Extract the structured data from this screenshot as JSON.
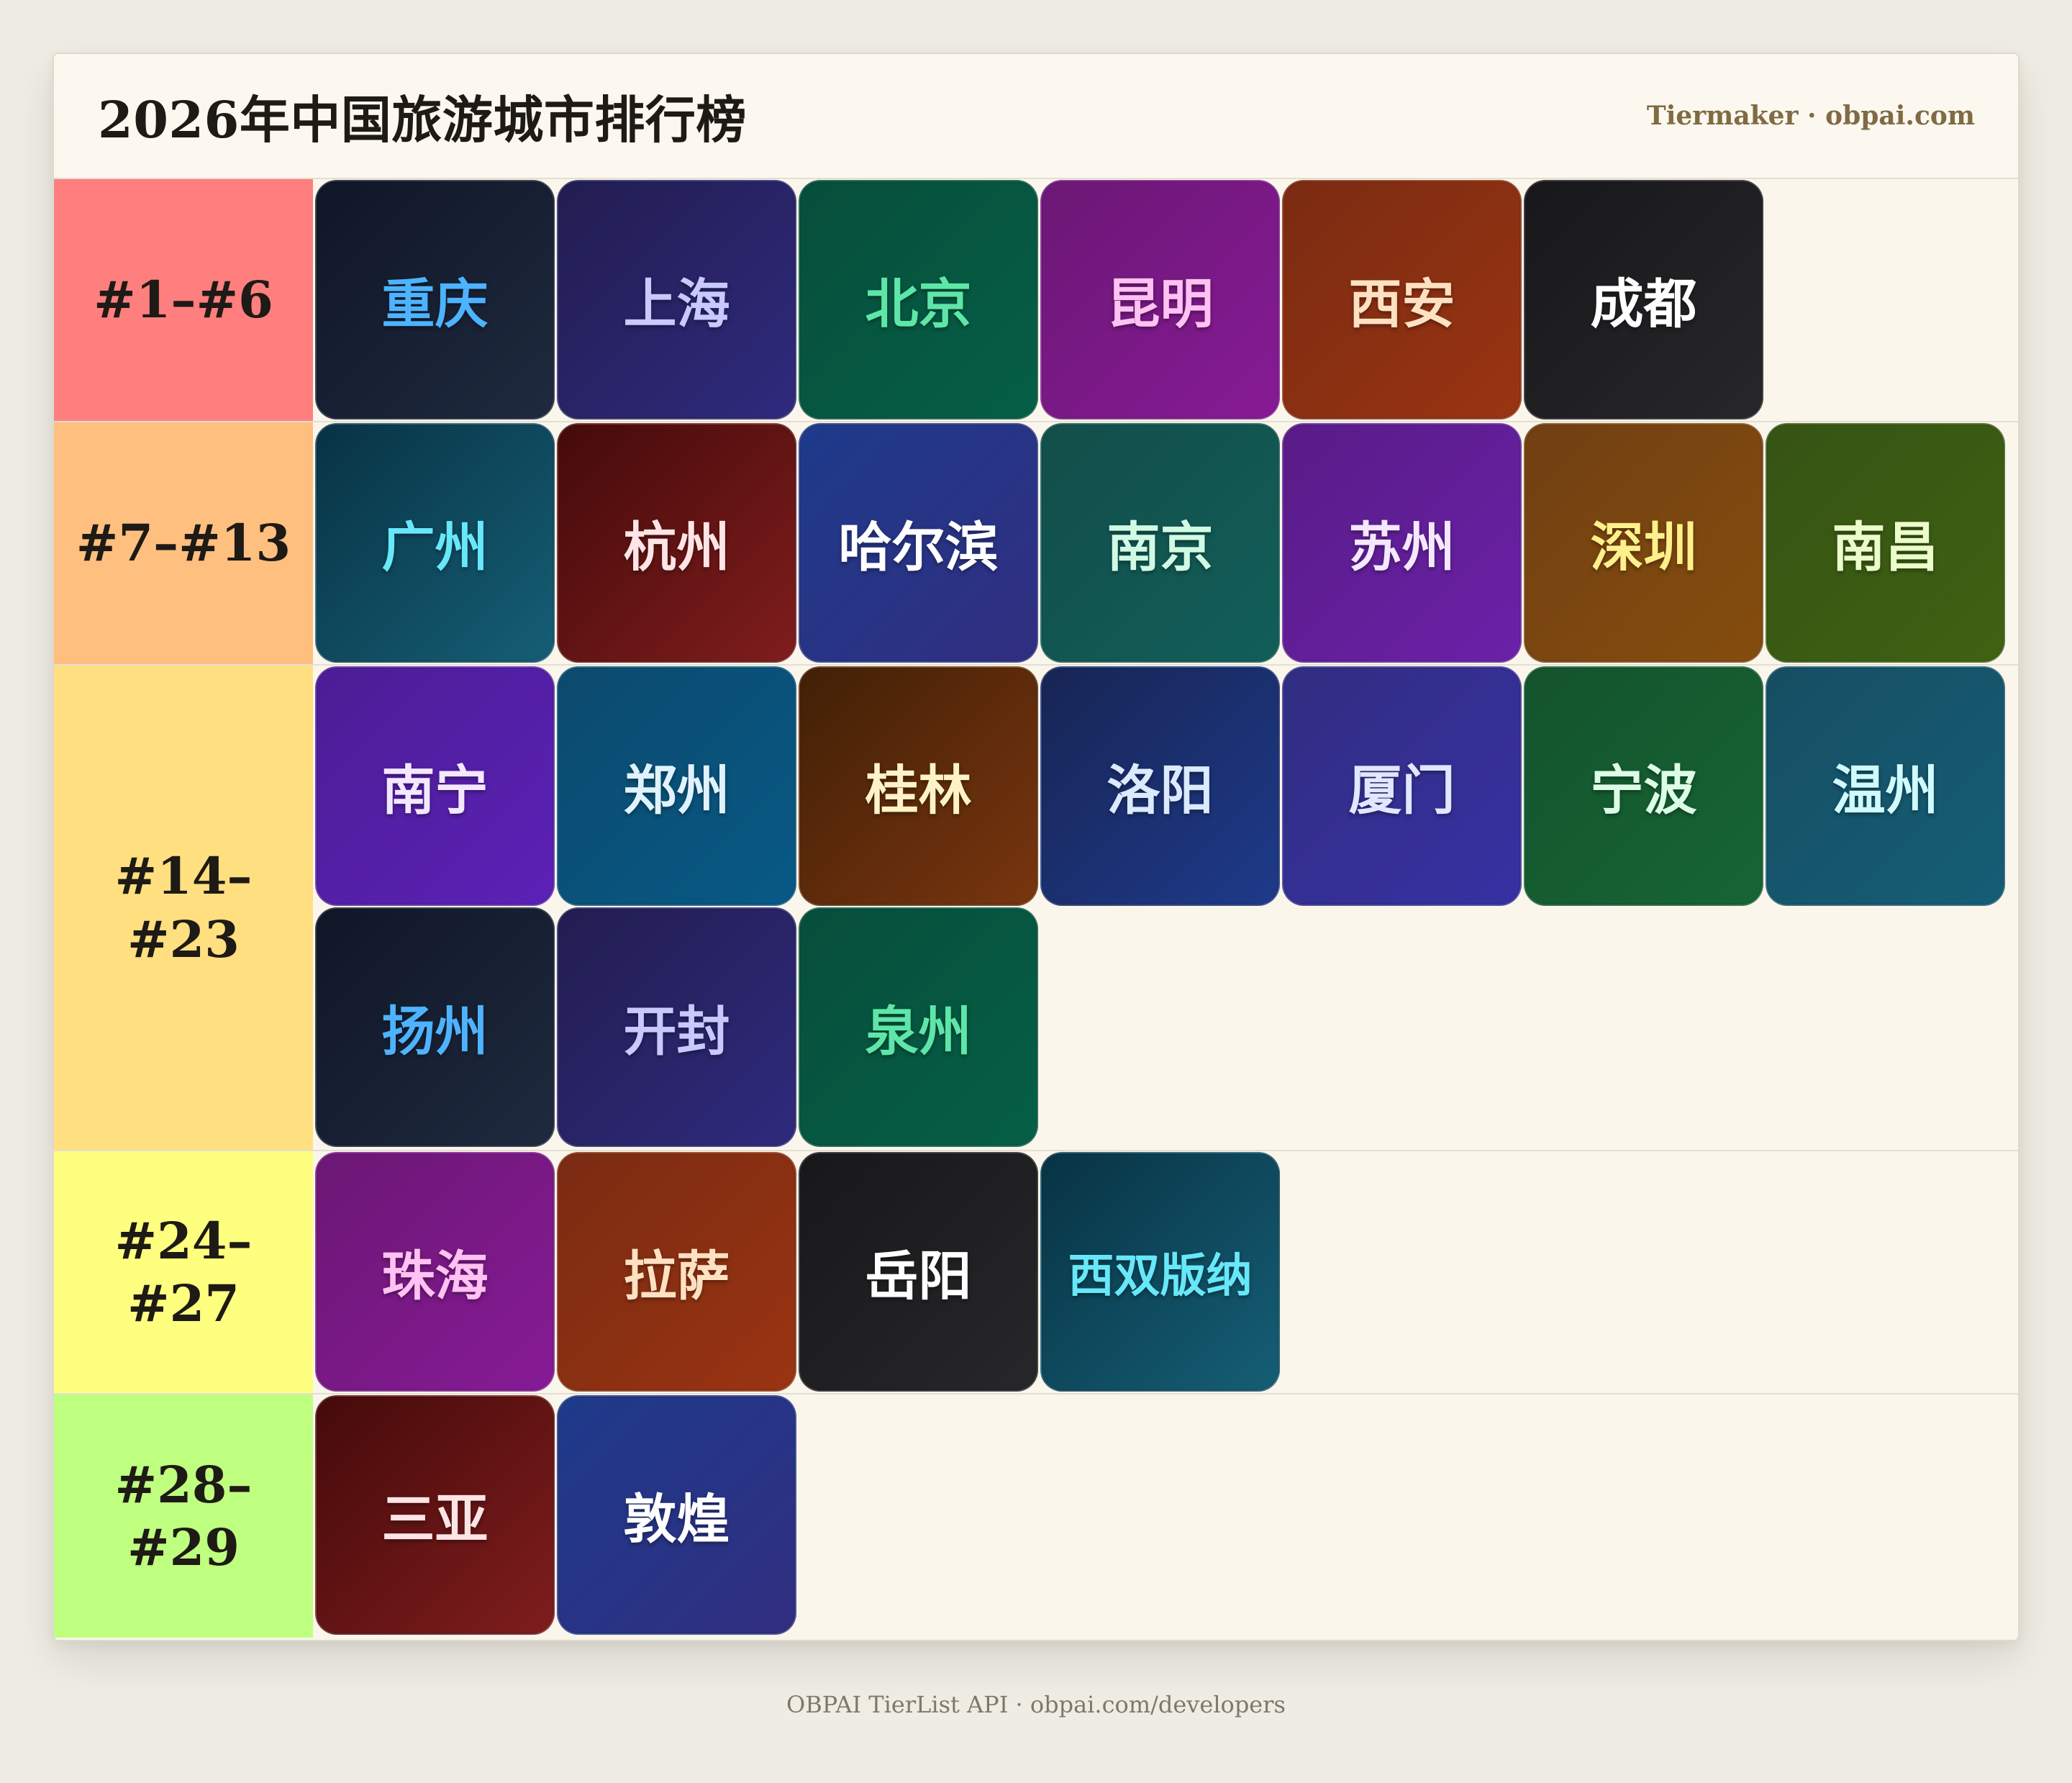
{
  "header": {
    "title": "2026年中国旅游城市排行榜",
    "brand": "Tiermaker · obpai.com"
  },
  "tiers": [
    {
      "label": "#1–#6",
      "color": "#ff7f7f",
      "items": [
        {
          "name": "重庆",
          "text_color": "#4db3ff",
          "bg": [
            "#0f1627",
            "#1f2a3e"
          ]
        },
        {
          "name": "上海",
          "text_color": "#c7c9ff",
          "bg": [
            "#221d50",
            "#2f2a7d"
          ]
        },
        {
          "name": "北京",
          "text_color": "#5ee6a8",
          "bg": [
            "#064e3b",
            "#065f46"
          ]
        },
        {
          "name": "昆明",
          "text_color": "#ffc2f2",
          "bg": [
            "#6c1875",
            "#861a95"
          ]
        },
        {
          "name": "西安",
          "text_color": "#ffe1c2",
          "bg": [
            "#7a2b12",
            "#9a3412"
          ]
        },
        {
          "name": "成都",
          "text_color": "#ffffff",
          "bg": [
            "#18181b",
            "#27272a"
          ]
        }
      ]
    },
    {
      "label": "#7–#13",
      "color": "#ffbf7f",
      "items": [
        {
          "name": "广州",
          "text_color": "#67e8f9",
          "bg": [
            "#083344",
            "#155e75"
          ]
        },
        {
          "name": "杭州",
          "text_color": "#ffe4e6",
          "bg": [
            "#450a0a",
            "#7f1d1d"
          ]
        },
        {
          "name": "哈尔滨",
          "text_color": "#ffffff",
          "bg": [
            "#1e3a8a",
            "#312e81"
          ]
        },
        {
          "name": "南京",
          "text_color": "#d1fae5",
          "bg": [
            "#134e4a",
            "#115e59"
          ]
        },
        {
          "name": "苏州",
          "text_color": "#f3e8ff",
          "bg": [
            "#581c87",
            "#6b21a8"
          ]
        },
        {
          "name": "深圳",
          "text_color": "#fef08a",
          "bg": [
            "#713f12",
            "#854d0e"
          ]
        },
        {
          "name": "南昌",
          "text_color": "#ecfccb",
          "bg": [
            "#365314",
            "#3f6212"
          ]
        }
      ]
    },
    {
      "label": "#14–#23",
      "color": "#ffdf80",
      "items": [
        {
          "name": "南宁",
          "text_color": "#f3e8ff",
          "bg": [
            "#4c1d95",
            "#5b21b6"
          ]
        },
        {
          "name": "郑州",
          "text_color": "#e0f2fe",
          "bg": [
            "#0c4a6e",
            "#075985"
          ]
        },
        {
          "name": "桂林",
          "text_color": "#fef3c7",
          "bg": [
            "#422006",
            "#78350f"
          ]
        },
        {
          "name": "洛阳",
          "text_color": "#dbeafe",
          "bg": [
            "#172554",
            "#1e3a8a"
          ]
        },
        {
          "name": "厦门",
          "text_color": "#e0e7ff",
          "bg": [
            "#312e81",
            "#3730a3"
          ]
        },
        {
          "name": "宁波",
          "text_color": "#dcfce7",
          "bg": [
            "#14532d",
            "#166534"
          ]
        },
        {
          "name": "温州",
          "text_color": "#cffafe",
          "bg": [
            "#164e63",
            "#155e75"
          ]
        },
        {
          "name": "扬州",
          "text_color": "#4db3ff",
          "bg": [
            "#0f1627",
            "#1f2a3e"
          ]
        },
        {
          "name": "开封",
          "text_color": "#c7c9ff",
          "bg": [
            "#221d50",
            "#2f2a7d"
          ]
        },
        {
          "name": "泉州",
          "text_color": "#5ee6a8",
          "bg": [
            "#064e3b",
            "#065f46"
          ]
        }
      ]
    },
    {
      "label": "#24–#27",
      "color": "#ffff7f",
      "items": [
        {
          "name": "珠海",
          "text_color": "#ffc2f2",
          "bg": [
            "#6c1875",
            "#861a95"
          ]
        },
        {
          "name": "拉萨",
          "text_color": "#ffe1c2",
          "bg": [
            "#7a2b12",
            "#9a3412"
          ]
        },
        {
          "name": "岳阳",
          "text_color": "#ffffff",
          "bg": [
            "#18181b",
            "#27272a"
          ]
        },
        {
          "name": "西双版纳",
          "text_color": "#67e8f9",
          "bg": [
            "#083344",
            "#155e75"
          ]
        }
      ]
    },
    {
      "label": "#28–#29",
      "color": "#bfff7f",
      "items": [
        {
          "name": "三亚",
          "text_color": "#ffe4e6",
          "bg": [
            "#450a0a",
            "#7f1d1d"
          ]
        },
        {
          "name": "敦煌",
          "text_color": "#ffffff",
          "bg": [
            "#1e3a8a",
            "#312e81"
          ]
        }
      ]
    }
  ],
  "footer": {
    "text": "OBPAI TierList API · obpai.com/developers"
  }
}
